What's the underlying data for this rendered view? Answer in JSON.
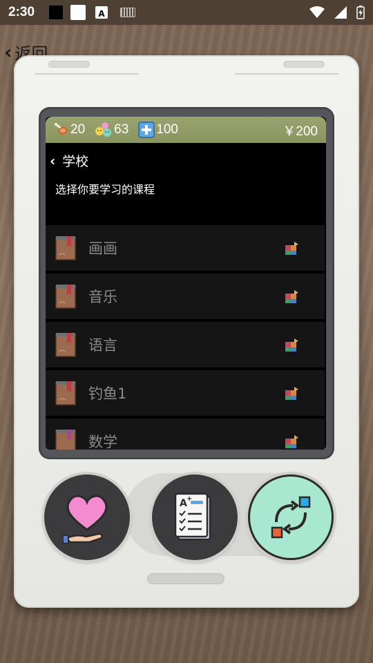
{
  "status_bar": {
    "time": "2:30",
    "keyboard_letter": "A"
  },
  "nav": {
    "back_label": "返回"
  },
  "stats": {
    "food": "20",
    "mood": "63",
    "health": "100",
    "money": "￥200"
  },
  "school": {
    "title": "学校",
    "subtitle": "选择你要学习的课程",
    "courses": [
      {
        "name": "画画"
      },
      {
        "name": "音乐"
      },
      {
        "name": "语言"
      },
      {
        "name": "钓鱼1"
      },
      {
        "name": "数学"
      }
    ]
  },
  "buttons": {
    "care": "heart-hand-icon",
    "tasks": "checklist-icon",
    "swap": "swap-icon"
  },
  "colors": {
    "stats_bar": "#8f9a63",
    "active_button": "#a8e8d0",
    "device": "#eeeeea"
  }
}
